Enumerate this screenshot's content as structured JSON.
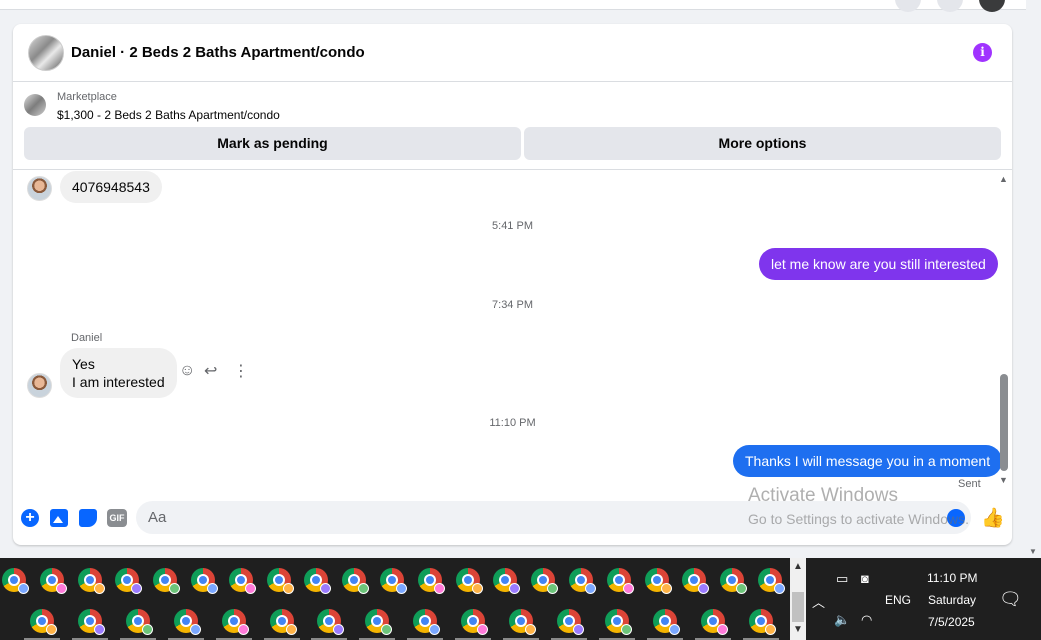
{
  "header": {
    "title": "Daniel · 2 Beds 2 Baths Apartment/condo",
    "info_icon": "i"
  },
  "listing": {
    "label": "Marketplace",
    "title": "$1,300 - 2 Beds 2 Baths Apartment/condo",
    "pending_button": "Mark as pending",
    "more_button": "More options"
  },
  "messages": {
    "m1": "4076948543",
    "t1": "5:41 PM",
    "m2": "let me know are you still interested",
    "t2": "7:34 PM",
    "sender": "Daniel",
    "m3_line1": "Yes",
    "m3_line2": "I am interested",
    "t3": "11:10 PM",
    "m4": "Thanks I will message you in a moment",
    "sent": "Sent"
  },
  "composer": {
    "placeholder": "Aa",
    "gif_label": "GIF",
    "plus_label": "+"
  },
  "watermark": {
    "line1": "Activate Windows",
    "line2": "Go to Settings to activate Windows."
  },
  "tray": {
    "lang": "ENG",
    "time": "11:10 PM",
    "day": "Saturday",
    "date": "7/5/2025"
  },
  "colors": {
    "outgoing_purple": "#7f35ed",
    "outgoing_blue": "#1e6ff0",
    "messenger_blue": "#0866ff",
    "info_purple": "#a033ff"
  }
}
